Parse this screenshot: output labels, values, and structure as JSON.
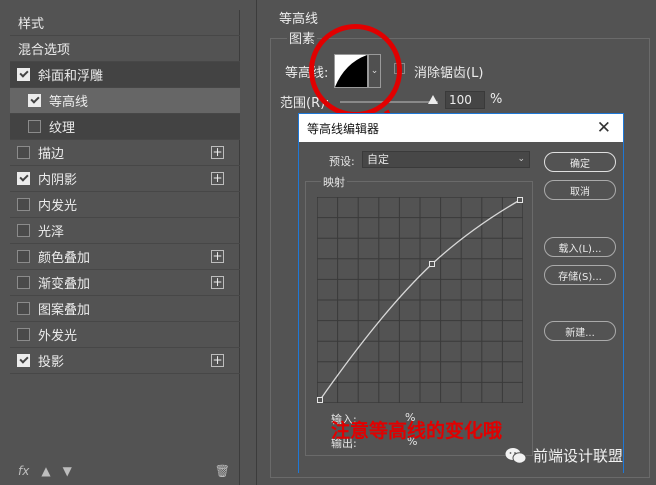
{
  "left_panel": {
    "header": "样式",
    "blend": "混合选项",
    "items": [
      {
        "label": "斜面和浮雕",
        "checked": true,
        "plus": false,
        "sub": false
      },
      {
        "label": "等高线",
        "checked": true,
        "plus": false,
        "sub": true,
        "selected": true
      },
      {
        "label": "纹理",
        "checked": false,
        "plus": false,
        "sub": true
      },
      {
        "label": "描边",
        "checked": false,
        "plus": true
      },
      {
        "label": "内阴影",
        "checked": true,
        "plus": true
      },
      {
        "label": "内发光",
        "checked": false,
        "plus": false
      },
      {
        "label": "光泽",
        "checked": false,
        "plus": false
      },
      {
        "label": "颜色叠加",
        "checked": false,
        "plus": true
      },
      {
        "label": "渐变叠加",
        "checked": false,
        "plus": true
      },
      {
        "label": "图案叠加",
        "checked": false,
        "plus": false
      },
      {
        "label": "外发光",
        "checked": false,
        "plus": false
      },
      {
        "label": "投影",
        "checked": true,
        "plus": true
      }
    ],
    "footer_fx": "fx"
  },
  "contour_panel": {
    "title": "等高线",
    "group": "图素",
    "contour_label": "等高线:",
    "antialias_label": "消除锯齿(L)",
    "range_label": "范围(R):",
    "range_value": "100",
    "range_unit": "%"
  },
  "editor": {
    "title": "等高线编辑器",
    "close": "✕",
    "preset_label": "预设:",
    "preset_value": "自定",
    "mapping_label": "映射",
    "input_label": "输入:",
    "output_label": "输出:",
    "percent": "%",
    "buttons": {
      "ok": "确定",
      "cancel": "取消",
      "load": "载入(L)...",
      "save": "存储(S)...",
      "new": "新建..."
    }
  },
  "annotation": "注意等高线的变化哦",
  "watermark": "前端设计联盟",
  "colors": {
    "annotation": "#e10000",
    "panel_bg": "#535353"
  }
}
